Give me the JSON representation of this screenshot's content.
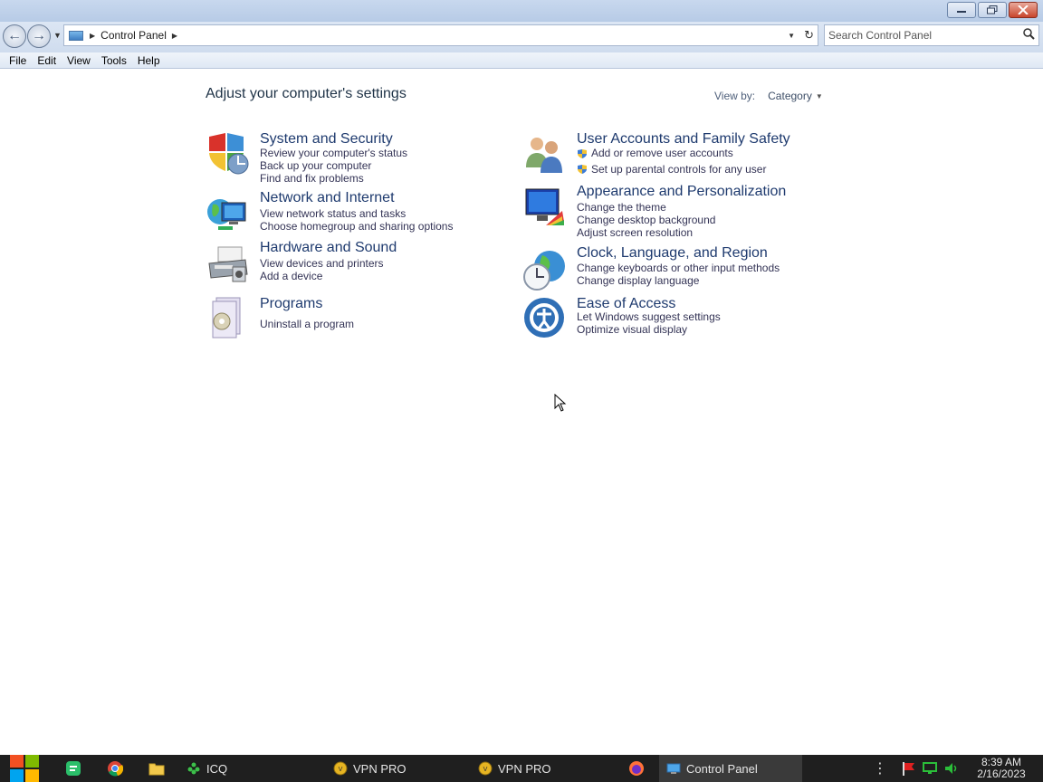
{
  "window": {
    "buttons": [
      "minimize",
      "restore",
      "close"
    ]
  },
  "navigation": {
    "breadcrumb": "Control Panel",
    "search_placeholder": "Search Control Panel"
  },
  "menu": [
    "File",
    "Edit",
    "View",
    "Tools",
    "Help"
  ],
  "main": {
    "title": "Adjust your computer's settings",
    "view_by_label": "View by:",
    "view_by_value": "Category",
    "categories_left": [
      {
        "title": "System and Security",
        "links": [
          "Review your computer's status",
          "Back up your computer",
          "Find and fix problems"
        ],
        "icon": "shield-icon"
      },
      {
        "title": "Network and Internet",
        "links": [
          "View network status and tasks",
          "Choose homegroup and sharing options"
        ],
        "icon": "network-icon"
      },
      {
        "title": "Hardware and Sound",
        "links": [
          "View devices and printers",
          "Add a device"
        ],
        "icon": "printer-icon"
      },
      {
        "title": "Programs",
        "links": [
          "Uninstall a program"
        ],
        "icon": "programs-icon"
      }
    ],
    "categories_right": [
      {
        "title": "User Accounts and Family Safety",
        "links": [
          "Add or remove user accounts",
          "Set up parental controls for any user"
        ],
        "icon": "users-icon"
      },
      {
        "title": "Appearance and Personalization",
        "links": [
          "Change the theme",
          "Change desktop background",
          "Adjust screen resolution"
        ],
        "icon": "monitor-paint-icon"
      },
      {
        "title": "Clock, Language, and Region",
        "links": [
          "Change keyboards or other input methods",
          "Change display language"
        ],
        "icon": "clock-globe-icon"
      },
      {
        "title": "Ease of Access",
        "links": [
          "Let Windows suggest settings",
          "Optimize visual display"
        ],
        "icon": "ease-of-access-icon"
      }
    ]
  },
  "taskbar": {
    "apps": [
      {
        "label": "ICQ",
        "icon": "icq-icon"
      },
      {
        "label": "VPN PRO",
        "icon": "vpn-icon"
      },
      {
        "label": "VPN PRO",
        "icon": "vpn-icon"
      },
      {
        "label": "Control Panel",
        "icon": "control-panel-icon"
      }
    ],
    "time": "8:39 AM",
    "date": "2/16/2023"
  },
  "colors": {
    "accent": "#1e3a6e",
    "taskbar": "#1f1f1f"
  }
}
